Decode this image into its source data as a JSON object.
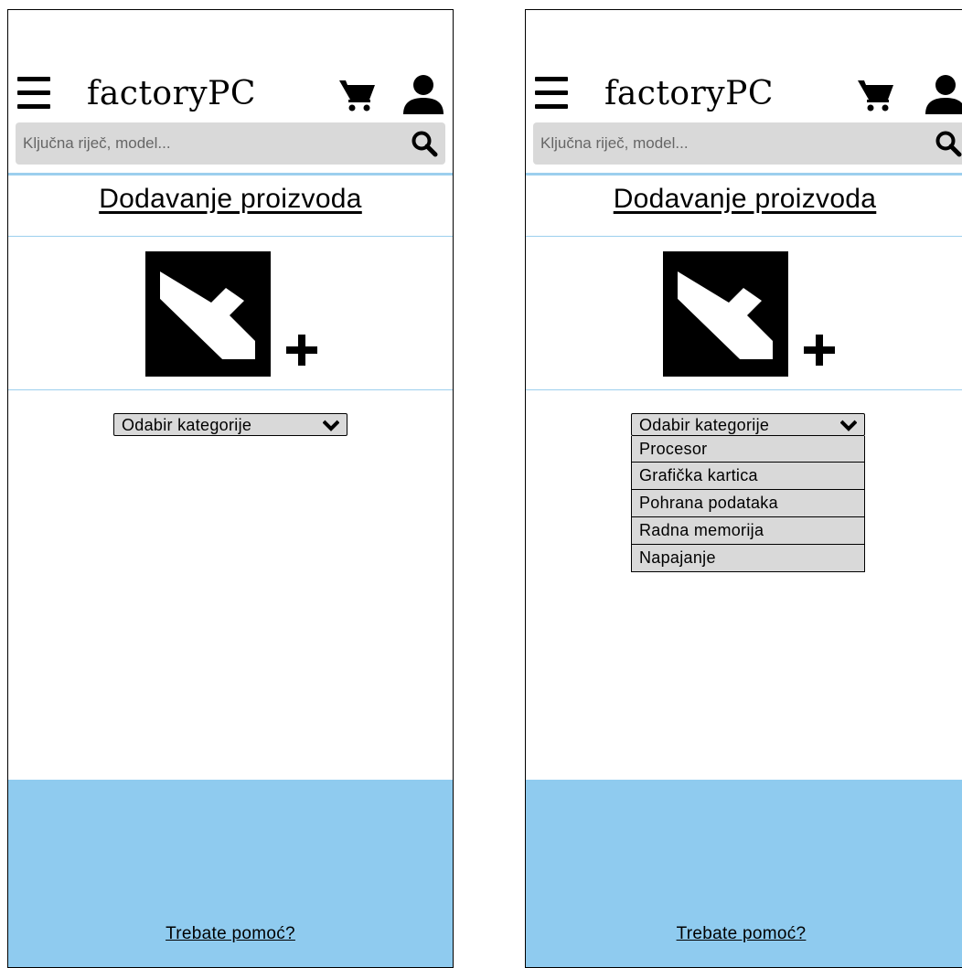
{
  "screens": {
    "left": {
      "brand": "factoryPC",
      "search_placeholder": "Ključna riječ, model...",
      "page_title": "Dodavanje proizvoda",
      "category_select_label": "Odabir kategorije",
      "help_link": "Trebate pomoć?",
      "dropdown_open": false
    },
    "right": {
      "brand": "factoryPC",
      "search_placeholder": "Ključna riječ, model...",
      "page_title": "Dodavanje proizvoda",
      "category_select_label": "Odabir kategorije",
      "category_options": [
        "Procesor",
        "Grafička kartica",
        "Pohrana podataka",
        "Radna memorija",
        "Napajanje"
      ],
      "help_link": "Trebate pomoć?",
      "dropdown_open": true
    }
  },
  "icons": {
    "menu": "hamburger-menu-icon",
    "cart": "shopping-cart-icon",
    "user": "user-icon",
    "search": "search-icon",
    "add_image": "add-image-icon",
    "dropdown": "chevron-down-icon"
  },
  "colors": {
    "accent_light_blue": "#8fcbef",
    "divider_blue": "#9ccfee",
    "input_gray": "#d9d9d9",
    "text_gray": "#666666"
  }
}
